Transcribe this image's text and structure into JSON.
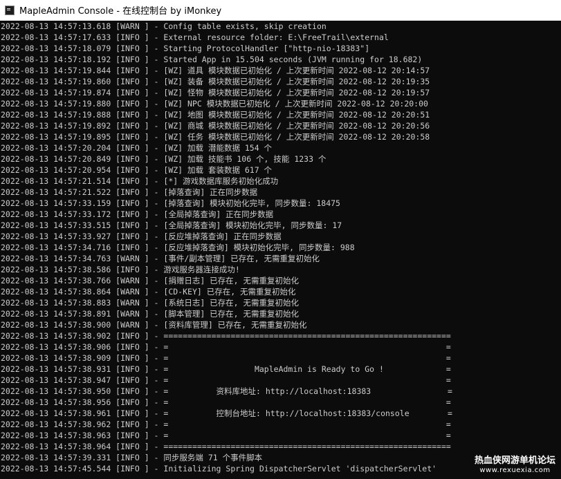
{
  "window": {
    "title": "MapleAdmin Console - 在线控制台 by iMonkey"
  },
  "console": {
    "lines": [
      "2022-08-13 14:57:13.618 [WARN ] - Config table exists, skip creation",
      "2022-08-13 14:57:17.633 [INFO ] - External resource folder: E:\\FreeTrail\\external",
      "2022-08-13 14:57:18.079 [INFO ] - Starting ProtocolHandler [\"http-nio-18383\"]",
      "2022-08-13 14:57:18.192 [INFO ] - Started App in 15.504 seconds (JVM running for 18.682)",
      "2022-08-13 14:57:19.844 [INFO ] - [WZ] 道具 模块数据已初始化 / 上次更新时间 2022-08-12 20:14:57",
      "2022-08-13 14:57:19.860 [INFO ] - [WZ] 装备 模块数据已初始化 / 上次更新时间 2022-08-12 20:19:35",
      "2022-08-13 14:57:19.874 [INFO ] - [WZ] 怪物 模块数据已初始化 / 上次更新时间 2022-08-12 20:19:57",
      "2022-08-13 14:57:19.880 [INFO ] - [WZ] NPC 模块数据已初始化 / 上次更新时间 2022-08-12 20:20:00",
      "2022-08-13 14:57:19.888 [INFO ] - [WZ] 地图 模块数据已初始化 / 上次更新时间 2022-08-12 20:20:51",
      "2022-08-13 14:57:19.892 [INFO ] - [WZ] 商城 模块数据已初始化 / 上次更新时间 2022-08-12 20:20:56",
      "2022-08-13 14:57:19.895 [INFO ] - [WZ] 任务 模块数据已初始化 / 上次更新时间 2022-08-12 20:20:58",
      "2022-08-13 14:57:20.204 [INFO ] - [WZ] 加载 潜能数据 154 个",
      "2022-08-13 14:57:20.849 [INFO ] - [WZ] 加载 技能书 106 个, 技能 1233 个",
      "2022-08-13 14:57:20.954 [INFO ] - [WZ] 加载 套装数据 617 个",
      "2022-08-13 14:57:21.514 [INFO ] - [*] 游戏数据库服务初始化成功",
      "2022-08-13 14:57:21.522 [INFO ] - [掉落查询] 正在同步数据",
      "2022-08-13 14:57:33.159 [INFO ] - [掉落查询] 模块初始化完毕, 同步数量: 18475",
      "2022-08-13 14:57:33.172 [INFO ] - [全局掉落查询] 正在同步数据",
      "2022-08-13 14:57:33.515 [INFO ] - [全局掉落查询] 模块初始化完毕, 同步数量: 17",
      "2022-08-13 14:57:33.927 [INFO ] - [反应堆掉落查询] 正在同步数据",
      "2022-08-13 14:57:34.716 [INFO ] - [反应堆掉落查询] 模块初始化完毕, 同步数量: 988",
      "2022-08-13 14:57:34.763 [WARN ] - [事件/副本管理] 已存在, 无需重复初始化",
      "2022-08-13 14:57:38.586 [INFO ] - 游戏服务器连接成功!",
      "2022-08-13 14:57:38.766 [WARN ] - [捐赠日志] 已存在, 无需重复初始化",
      "2022-08-13 14:57:38.864 [WARN ] - [CD-KEY] 已存在, 无需重复初始化",
      "2022-08-13 14:57:38.883 [WARN ] - [系统日志] 已存在, 无需重复初始化",
      "2022-08-13 14:57:38.891 [WARN ] - [脚本管理] 已存在, 无需重复初始化",
      "2022-08-13 14:57:38.900 [WARN ] - [资料库管理] 已存在, 无需重复初始化",
      "2022-08-13 14:57:38.902 [INFO ] - ============================================================",
      "2022-08-13 14:57:38.906 [INFO ] - =                                                          =",
      "2022-08-13 14:57:38.909 [INFO ] - =                                                          =",
      "2022-08-13 14:57:38.931 [INFO ] - =                  MapleAdmin is Ready to Go !             =",
      "2022-08-13 14:57:38.947 [INFO ] - =                                                          =",
      "2022-08-13 14:57:38.950 [INFO ] - =          资料库地址: http://localhost:18383                =",
      "2022-08-13 14:57:38.956 [INFO ] - =                                                          =",
      "2022-08-13 14:57:38.961 [INFO ] - =          控制台地址: http://localhost:18383/console        =",
      "2022-08-13 14:57:38.962 [INFO ] - =                                                          =",
      "2022-08-13 14:57:38.963 [INFO ] - =                                                          =",
      "2022-08-13 14:57:38.964 [INFO ] - ============================================================",
      "2022-08-13 14:57:39.331 [INFO ] - 同步服务端 71 个事件脚本",
      "2022-08-13 14:57:45.544 [INFO ] - Initializing Spring DispatcherServlet 'dispatcherServlet'"
    ]
  },
  "watermark": {
    "title": "热血侠网游单机论坛",
    "url": "www.rexuexia.com"
  }
}
